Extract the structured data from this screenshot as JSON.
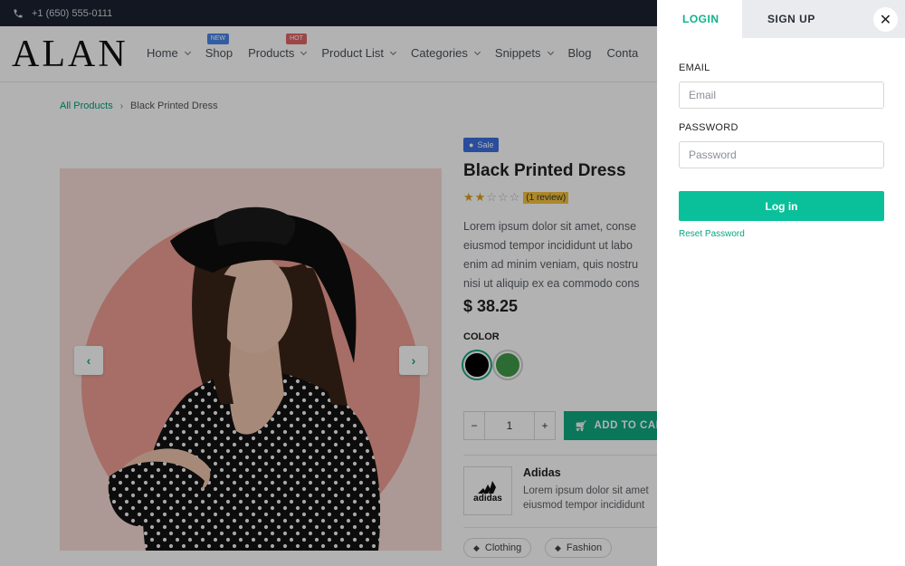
{
  "topbar": {
    "phone_icon": "phone-icon",
    "phone": "+1 (650) 555-0111"
  },
  "header": {
    "logo": "ALAN",
    "nav": [
      {
        "label": "Home",
        "has_caret": true
      },
      {
        "label": "Shop",
        "has_caret": false,
        "badge": "NEW"
      },
      {
        "label": "Products",
        "has_caret": true,
        "badge": "HOT"
      },
      {
        "label": "Product List",
        "has_caret": true
      },
      {
        "label": "Categories",
        "has_caret": true
      },
      {
        "label": "Snippets",
        "has_caret": true
      },
      {
        "label": "Blog",
        "has_caret": false
      },
      {
        "label": "Conta",
        "has_caret": false
      }
    ]
  },
  "breadcrumb": {
    "link": "All Products",
    "separator": "›",
    "current": "Black Printed Dress"
  },
  "gallery": {
    "prev_icon": "chevron-left-icon",
    "next_icon": "chevron-right-icon",
    "prev": "‹",
    "next": "›"
  },
  "product": {
    "sale_badge": "Sale",
    "title": "Black Printed Dress",
    "rating": 2,
    "rating_max": 5,
    "review_count": "(1 review)",
    "description": [
      "Lorem ipsum dolor sit amet, conse",
      "eiusmod tempor incididunt ut labo",
      "enim ad minim veniam, quis nostru",
      "nisi ut aliquip ex ea commodo cons"
    ],
    "price": "$ 38.25",
    "color_label": "COLOR",
    "colors": [
      "#000000",
      "#3f9b48"
    ],
    "qty_minus": "−",
    "qty_value": "1",
    "qty_plus": "+",
    "add_to_cart": "ADD TO CART",
    "brand": {
      "name": "Adidas",
      "logo_text": "adidas",
      "description": [
        "Lorem ipsum dolor sit amet",
        "eiusmod tempor incididunt"
      ]
    },
    "tags": [
      "Clothing",
      "Fashion"
    ]
  },
  "login_panel": {
    "tab_login": "LOGIN",
    "tab_signup": "SIGN UP",
    "close": "✕",
    "email_label": "EMAIL",
    "email_placeholder": "Email",
    "password_label": "PASSWORD",
    "password_placeholder": "Password",
    "login_button": "Log in",
    "reset_link": "Reset Password"
  },
  "colors": {
    "accent": "#0ac09a",
    "topbar": "#1c2230",
    "sale": "#3d6fe0"
  }
}
